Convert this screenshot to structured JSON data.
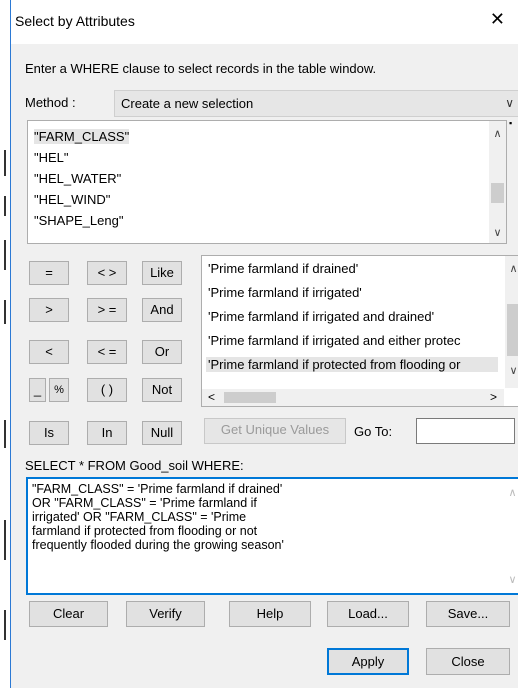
{
  "window": {
    "title": "Select by Attributes",
    "close_glyph": "✕"
  },
  "instructions": "Enter a WHERE clause to select records in the table window.",
  "method": {
    "label": "Method :",
    "value": "Create a new selection"
  },
  "fields": {
    "items": [
      "\"FARM_CLASS\"",
      "\"HEL\"",
      "\"HEL_WATER\"",
      "\"HEL_WIND\"",
      "\"SHAPE_Leng\""
    ],
    "selected_index": 0
  },
  "operators": {
    "equals": "=",
    "not_equal": "< >",
    "like": "Like",
    "greater": ">",
    "greater_equal": "> =",
    "and": "And",
    "less": "<",
    "less_equal": "< =",
    "or": "Or",
    "underscore": "_",
    "percent": "%",
    "parens": "( )",
    "not": "Not",
    "is": "Is",
    "in": "In",
    "null": "Null"
  },
  "values": {
    "items": [
      "'Prime farmland if drained'",
      "'Prime farmland if irrigated'",
      "'Prime farmland if irrigated and drained'",
      "'Prime farmland if irrigated and either protec",
      "'Prime farmland if protected from flooding or"
    ],
    "selected_index": 4
  },
  "get_unique_values_label": "Get Unique Values",
  "goto": {
    "label": "Go To:",
    "value": ""
  },
  "select_clause": "SELECT * FROM Good_soil WHERE:",
  "expression": "\"FARM_CLASS\" = 'Prime farmland if drained' OR \"FARM_CLASS\" = 'Prime farmland if irrigated' OR \"FARM_CLASS\" = 'Prime farmland if protected from flooding or not frequently flooded during the growing season'",
  "buttons": {
    "clear": "Clear",
    "verify": "Verify",
    "help": "Help",
    "load": "Load...",
    "save": "Save...",
    "apply": "Apply",
    "close": "Close"
  },
  "icons": {
    "chevron_down": "∨",
    "chevron_up": "∧",
    "arrow_left": "<",
    "arrow_right": ">"
  }
}
